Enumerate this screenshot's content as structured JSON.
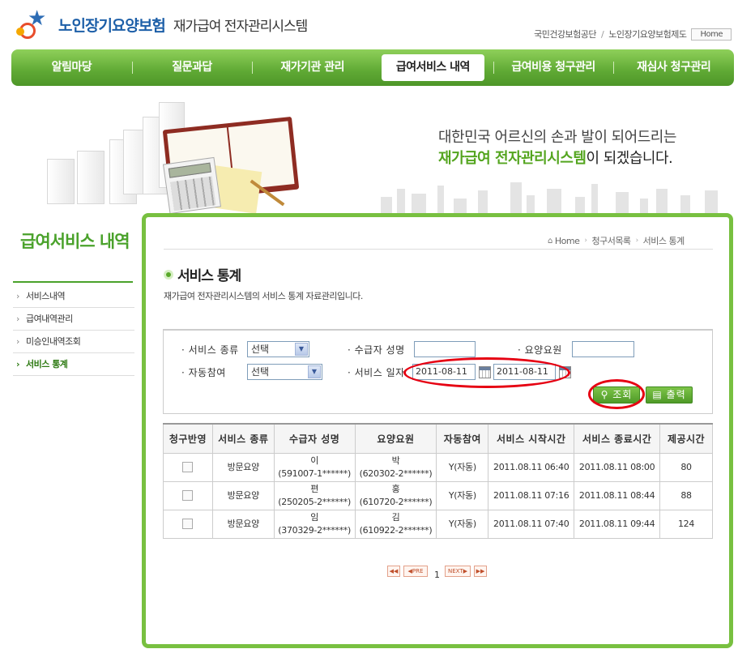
{
  "header": {
    "logo_main": "노인장기요양보험",
    "logo_sub": "재가급여 전자관리시스템",
    "links": [
      "국민건강보험공단",
      "노인장기요양보험제도"
    ],
    "link_separator": "/",
    "home_label": "Home"
  },
  "nav": {
    "items": [
      "알림마당",
      "질문과답",
      "재가기관 관리",
      "급여서비스 내역",
      "급여비용 청구관리",
      "재심사 청구관리"
    ],
    "active_index": 3
  },
  "banner": {
    "line1": "대한민국 어르신의 손과 발이 되어드리는",
    "line2_green": "재가급여 전자관리시스템",
    "line2_rest": "이 되겠습니다."
  },
  "left_menu": {
    "title": "급여서비스 내역",
    "items": [
      "서비스내역",
      "급여내역관리",
      "미승인내역조회",
      "서비스 통계"
    ],
    "active_index": 3
  },
  "breadcrumb": [
    "Home",
    "청구서목록",
    "서비스 통계"
  ],
  "page": {
    "title": "서비스 통계",
    "description": "재가급여 전자관리시스템의 서비스 통계 자료관리입니다."
  },
  "search": {
    "service_type_label": "· 서비스 종류",
    "service_type_value": "선택",
    "recipient_name_label": "· 수급자 성명",
    "recipient_name_value": "",
    "caregiver_label": "· 요양요원",
    "caregiver_value": "",
    "auto_label": "· 자동참여",
    "auto_value": "선택",
    "service_date_label": "· 서비스 일자",
    "date_from": "2011-08-11",
    "date_to": "2011-08-11",
    "search_button": "조회",
    "print_button": "출력"
  },
  "table": {
    "headers": [
      "청구반영",
      "서비스 종류",
      "수급자 성명",
      "요양요원",
      "자동참여",
      "서비스 시작시간",
      "서비스 종료시간",
      "제공시간"
    ],
    "rows": [
      {
        "service": "방문요양",
        "recipient_name": "이",
        "recipient_id": "(591007-1******)",
        "caregiver_name": "박",
        "caregiver_id": "(620302-2******)",
        "auto": "Y(자동)",
        "start": "2011.08.11 06:40",
        "end": "2011.08.11 08:00",
        "minutes": "80"
      },
      {
        "service": "방문요양",
        "recipient_name": "편",
        "recipient_id": "(250205-2******)",
        "caregiver_name": "홍",
        "caregiver_id": "(610720-2******)",
        "auto": "Y(자동)",
        "start": "2011.08.11 07:16",
        "end": "2011.08.11 08:44",
        "minutes": "88"
      },
      {
        "service": "방문요양",
        "recipient_name": "임",
        "recipient_id": "(370329-2******)",
        "caregiver_name": "김",
        "caregiver_id": "(610922-2******)",
        "auto": "Y(자동)",
        "start": "2011.08.11 07:40",
        "end": "2011.08.11 09:44",
        "minutes": "124"
      }
    ]
  },
  "pager": {
    "current_page": "1",
    "prev_label": "◀PRE",
    "next_label": "NEXT▶",
    "first_label": "◀◀",
    "last_label": "▶▶"
  },
  "colors": {
    "brand_green": "#5fa934",
    "highlight_red": "#e60012",
    "logo_blue": "#1d5fa8"
  }
}
